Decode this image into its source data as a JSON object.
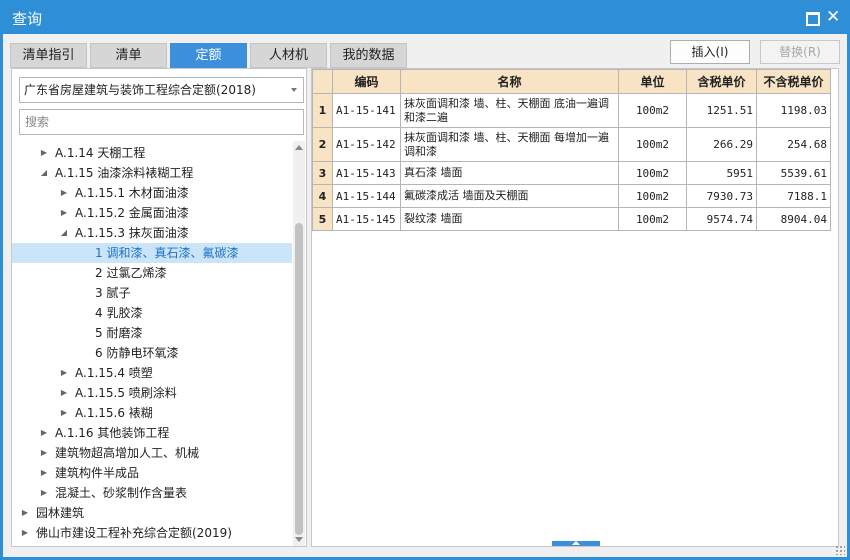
{
  "window": {
    "title": "查询"
  },
  "tabs": [
    {
      "label": "清单指引",
      "active": false
    },
    {
      "label": "清单",
      "active": false
    },
    {
      "label": "定额",
      "active": true
    },
    {
      "label": "人材机",
      "active": false
    },
    {
      "label": "我的数据",
      "active": false
    }
  ],
  "actions": {
    "insert_label": "插入(I)",
    "replace_label": "替换(R)"
  },
  "left": {
    "dropdown_value": "广东省房屋建筑与装饰工程综合定额(2018)",
    "search_placeholder": "搜索"
  },
  "tree": [
    {
      "label": "A.1.14 天棚工程",
      "level": 1,
      "arrow": "right"
    },
    {
      "label": "A.1.15 油漆涂料裱糊工程",
      "level": 1,
      "arrow": "down"
    },
    {
      "label": "A.1.15.1 木材面油漆",
      "level": 2,
      "arrow": "right"
    },
    {
      "label": "A.1.15.2 金属面油漆",
      "level": 2,
      "arrow": "right"
    },
    {
      "label": "A.1.15.3 抹灰面油漆",
      "level": 2,
      "arrow": "down"
    },
    {
      "label": "1 调和漆、真石漆、氟碳漆",
      "level": 3,
      "arrow": "",
      "selected": true
    },
    {
      "label": "2 过氯乙烯漆",
      "level": 3,
      "arrow": ""
    },
    {
      "label": "3 腻子",
      "level": 3,
      "arrow": ""
    },
    {
      "label": "4 乳胶漆",
      "level": 3,
      "arrow": ""
    },
    {
      "label": "5 耐磨漆",
      "level": 3,
      "arrow": ""
    },
    {
      "label": "6 防静电环氧漆",
      "level": 3,
      "arrow": ""
    },
    {
      "label": "A.1.15.4 喷塑",
      "level": 2,
      "arrow": "right"
    },
    {
      "label": "A.1.15.5 喷刷涂料",
      "level": 2,
      "arrow": "right"
    },
    {
      "label": "A.1.15.6 裱糊",
      "level": 2,
      "arrow": "right"
    },
    {
      "label": "A.1.16 其他装饰工程",
      "level": 1,
      "arrow": "right"
    },
    {
      "label": "建筑物超高增加人工、机械",
      "level": 1,
      "arrow": "right"
    },
    {
      "label": "建筑构件半成品",
      "level": 1,
      "arrow": "right"
    },
    {
      "label": "混凝土、砂浆制作含量表",
      "level": 1,
      "arrow": "right"
    },
    {
      "label": "园林建筑",
      "level": 0,
      "arrow": "right"
    },
    {
      "label": "佛山市建设工程补充综合定额(2019)",
      "level": 0,
      "arrow": "right"
    }
  ],
  "table": {
    "columns": [
      "编码",
      "名称",
      "单位",
      "含税单价",
      "不含税单价"
    ],
    "rows": [
      {
        "num": "1",
        "code": "A1-15-141",
        "name": "抹灰面调和漆 墙、柱、天棚面 底油一遍调和漆二遍",
        "unit": "100m2",
        "price_tax": "1251.51",
        "price_notax": "1198.03"
      },
      {
        "num": "2",
        "code": "A1-15-142",
        "name": "抹灰面调和漆 墙、柱、天棚面 每增加一遍调和漆",
        "unit": "100m2",
        "price_tax": "266.29",
        "price_notax": "254.68"
      },
      {
        "num": "3",
        "code": "A1-15-143",
        "name": "真石漆 墙面",
        "unit": "100m2",
        "price_tax": "5951",
        "price_notax": "5539.61"
      },
      {
        "num": "4",
        "code": "A1-15-144",
        "name": "氟碳漆成活 墙面及天棚面",
        "unit": "100m2",
        "price_tax": "7930.73",
        "price_notax": "7188.1"
      },
      {
        "num": "5",
        "code": "A1-15-145",
        "name": "裂纹漆 墙面",
        "unit": "100m2",
        "price_tax": "9574.74",
        "price_notax": "8904.04"
      }
    ]
  },
  "colors": {
    "accent": "#2f8fd6",
    "tab_active": "#3b8fdb",
    "header_bg": "#f8e3c4",
    "selected_bg": "#cce4f7"
  }
}
